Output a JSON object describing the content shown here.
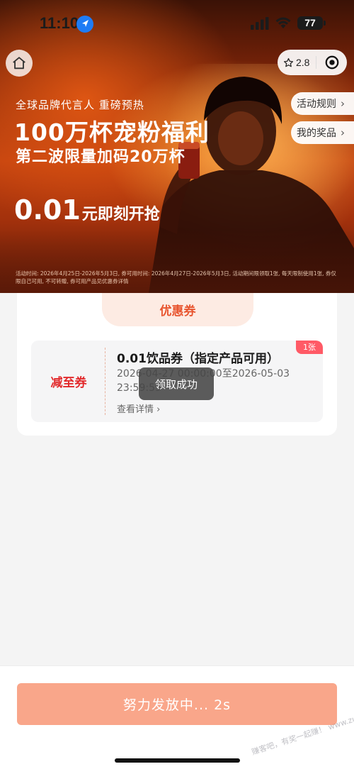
{
  "status_bar": {
    "time": "11:10",
    "battery": "77"
  },
  "capsule": {
    "rating": "2.8"
  },
  "hero": {
    "subtitle": "全球品牌代言人  重磅预热",
    "title": "100万杯宠粉福利",
    "line2": "第二波限量加码20万杯",
    "price_amount": "0.01",
    "price_text": "元即刻开抢",
    "fine_print": "活动时间: 2026年4月25日-2026年5月3日, 券可用时间: 2026年4月27日-2026年5月3日, 活动期间限领取1张, 每天限制使用1张, 券仅限自己可用, 不可转赠, 券可用产品见优惠券详情"
  },
  "side_links": {
    "rules": "活动规则",
    "prizes": "我的奖品"
  },
  "coupons": {
    "tab_label": "优惠券",
    "item": {
      "type_label": "减至券",
      "title": "0.01饮品券（指定产品可用）",
      "validity": "2026-04-27 00:00:00至2026-05-03 23:59:59",
      "detail_link": "查看详情",
      "badge": "1张"
    }
  },
  "toast": {
    "message": "领取成功"
  },
  "bottom": {
    "button_label": "努力发放中... 2s",
    "watermark": "赚客吧，有奖一起赚！ www.zuanke8.com"
  },
  "colors": {
    "accent": "#e8552f",
    "coupon_red": "#e2292b",
    "button": "#f9a68a",
    "badge": "#ff5a66"
  }
}
